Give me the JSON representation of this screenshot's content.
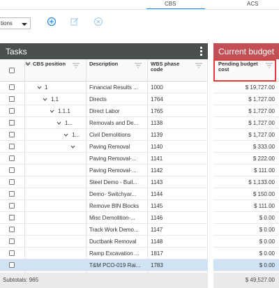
{
  "top_tabs": [
    {
      "label": "CBS",
      "active": true
    },
    {
      "label": "ACS",
      "active": false
    }
  ],
  "toolbar": {
    "select_value": "tions",
    "add_icon": "plus-circle-icon",
    "edit_icon": "edit-icon",
    "remove_icon": "x-circle-icon"
  },
  "tasks_panel": {
    "title": "Tasks",
    "columns": {
      "cbs_position": "CBS position",
      "description": "Description",
      "wbs_phase_code": "WBS phase code"
    }
  },
  "budget_panel": {
    "title": "Current budget",
    "column": "Pending budget cost"
  },
  "colors": {
    "tasks_header_bg": "#4a5050",
    "budget_header_bg": "#c24f55",
    "selected_row_bg": "#cfe3f5",
    "highlight_border": "#e53935",
    "tab_underline": "#1e88e5"
  },
  "rows": [
    {
      "cbs": "1",
      "desc": "Financial Results ...",
      "wbs": "1000",
      "amount": "$ 19,727.00"
    },
    {
      "cbs": "1.1",
      "desc": "Directs",
      "wbs": "1764",
      "amount": "$ 1,727.00"
    },
    {
      "cbs": "1.1.1",
      "desc": "Direct Labor",
      "wbs": "1765",
      "amount": "$ 1,727.00"
    },
    {
      "cbs": "1...",
      "desc": "Removals and De...",
      "wbs": "1138",
      "amount": "$ 1,727.00"
    },
    {
      "cbs": "1...",
      "desc": "Civil Demolitions",
      "wbs": "1139",
      "amount": "$ 1,727.00"
    },
    {
      "cbs": "",
      "desc": "Paving Removal",
      "wbs": "1140",
      "amount": "$ 333.00"
    },
    {
      "cbs": "",
      "desc": "Paving Removal-...",
      "wbs": "1141",
      "amount": "$ 222.00"
    },
    {
      "cbs": "",
      "desc": "Paving Removal-...",
      "wbs": "1142",
      "amount": "$ 111.00"
    },
    {
      "cbs": "",
      "desc": "Steel Demo - Buil...",
      "wbs": "1143",
      "amount": "$ 1,133.00"
    },
    {
      "cbs": "",
      "desc": "Demo- Switchyar...",
      "wbs": "1144",
      "amount": "$ 150.00"
    },
    {
      "cbs": "",
      "desc": "Remove BIN Blocks",
      "wbs": "1145",
      "amount": "$ 111.00"
    },
    {
      "cbs": "",
      "desc": "Misc Demolition-...",
      "wbs": "1146",
      "amount": "$ 0.00"
    },
    {
      "cbs": "",
      "desc": "Track Work Demo...",
      "wbs": "1147",
      "amount": "$ 0.00"
    },
    {
      "cbs": "",
      "desc": "Ductbank Removal",
      "wbs": "1148",
      "amount": "$ 0.00"
    },
    {
      "cbs": "",
      "desc": "Ramp Excavation ...",
      "wbs": "1817",
      "amount": "$ 0.00"
    },
    {
      "cbs": "",
      "desc": "T&M PCO-019 Rai...",
      "wbs": "1783",
      "amount": "$ 0.00"
    }
  ],
  "footer": {
    "subtotals": "Subtotals: 965",
    "total": "$ 49,527.00"
  }
}
